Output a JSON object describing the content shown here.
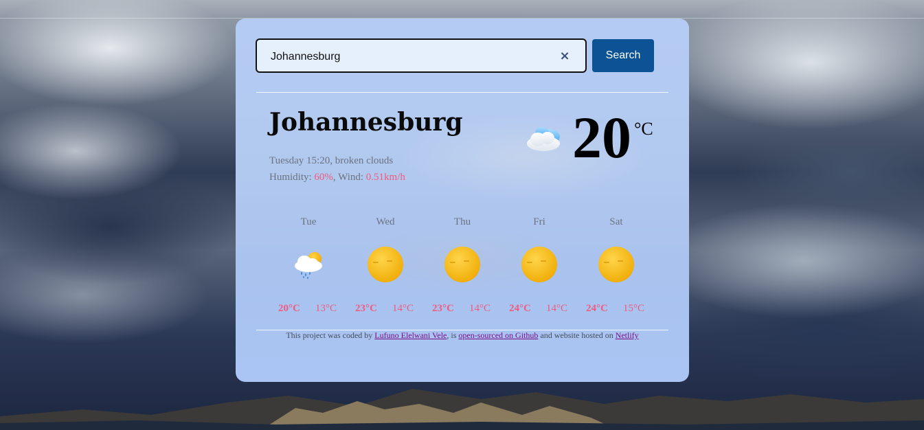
{
  "search": {
    "value": "Johannesburg",
    "clear_symbol": "×",
    "button_label": "Search"
  },
  "current": {
    "city": "Johannesburg",
    "description": "Tuesday 15:20, broken clouds",
    "humidity_label": "Humidity: ",
    "humidity_value": "60%",
    "wind_label": ", Wind: ",
    "wind_value": "0.51km/h",
    "temperature": "20",
    "unit": "°C",
    "icon": "broken-clouds-icon"
  },
  "forecast": [
    {
      "day": "Tue",
      "high": "20°C",
      "low": "13°C",
      "icon": "light-rain-icon"
    },
    {
      "day": "Wed",
      "high": "23°C",
      "low": "14°C",
      "icon": "sun-icon"
    },
    {
      "day": "Thu",
      "high": "23°C",
      "low": "14°C",
      "icon": "sun-icon"
    },
    {
      "day": "Fri",
      "high": "24°C",
      "low": "14°C",
      "icon": "sun-icon"
    },
    {
      "day": "Sat",
      "high": "24°C",
      "low": "15°C",
      "icon": "sun-icon"
    }
  ],
  "footer": {
    "prefix": "This project was coded by ",
    "author_link": "Lufuno Elelwani Vele",
    "middle": ", is ",
    "github_link": "open-sourced on Github",
    "middle2": " and website hosted on ",
    "host_link": "Netlify"
  },
  "colors": {
    "accent": "#f15b7e",
    "button": "#0b5394",
    "link": "#7a0d86"
  }
}
